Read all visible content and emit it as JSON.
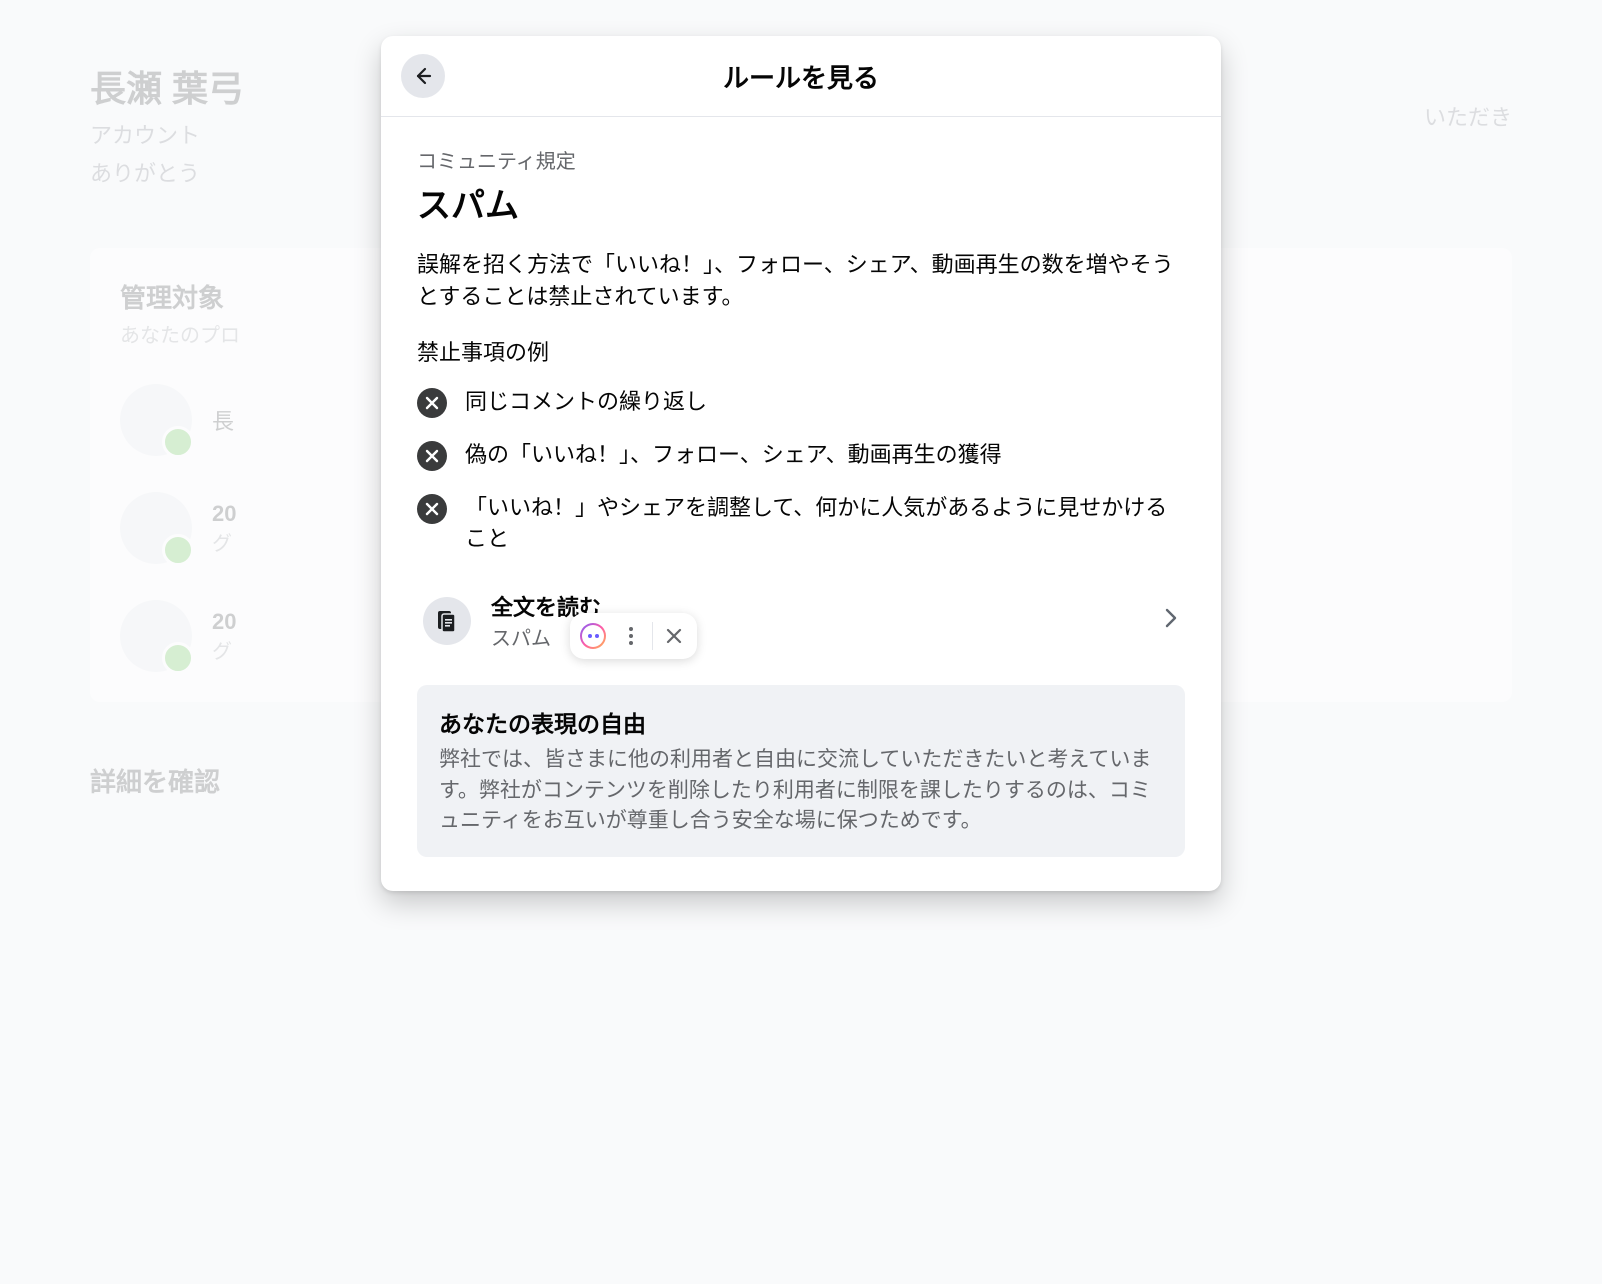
{
  "background": {
    "name": "長瀬 葉弓",
    "subtitle_line1": "アカウント",
    "subtitle_line2": "ありがとう",
    "thanks_suffix": "いただき",
    "card_title": "管理対象",
    "card_sub": "あなたのプロ",
    "item1": "長",
    "item2_year": "20",
    "item2_sub": "グ",
    "item3_year": "20",
    "item3_sub": "グ",
    "section": "詳細を確認"
  },
  "modal": {
    "title": "ルールを見る",
    "section_label": "コミュニティ規定",
    "heading": "スパム",
    "description": "誤解を招く方法で「いいね！」、フォロー、シェア、動画再生の数を増やそうとすることは禁止されています。",
    "list_heading": "禁止事項の例",
    "rules": [
      "同じコメントの繰り返し",
      "偽の「いいね！」、フォロー、シェア、動画再生の獲得",
      "「いいね！」やシェアを調整して、何かに人気があるように見せかけること"
    ],
    "read_full": {
      "title": "全文を読む",
      "subtitle": "スパム"
    },
    "footer": {
      "title": "あなたの表現の自由",
      "body": "弊社では、皆さまに他の利用者と自由に交流していただきたいと考えています。弊社がコンテンツを削除したり利用者に制限を課したりするのは、コミュニティをお互いが尊重し合う安全な場に保つためです。"
    }
  }
}
